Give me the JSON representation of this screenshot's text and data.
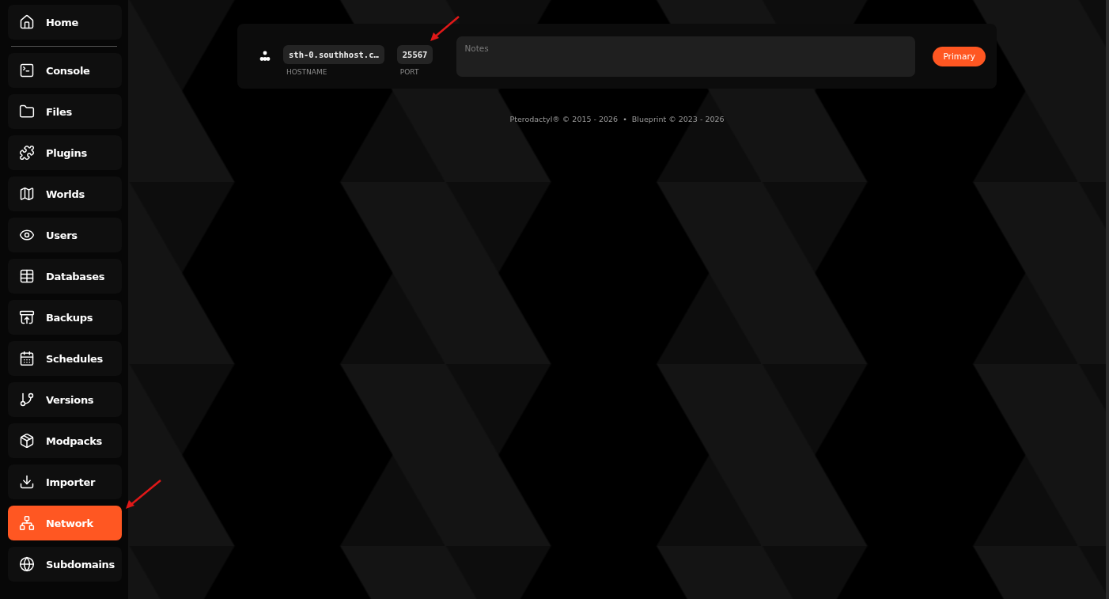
{
  "sidebar": {
    "items": [
      {
        "label": "Home",
        "selected": false
      },
      {
        "label": "Console",
        "selected": false
      },
      {
        "label": "Files",
        "selected": false
      },
      {
        "label": "Plugins",
        "selected": false
      },
      {
        "label": "Worlds",
        "selected": false
      },
      {
        "label": "Users",
        "selected": false
      },
      {
        "label": "Databases",
        "selected": false
      },
      {
        "label": "Backups",
        "selected": false
      },
      {
        "label": "Schedules",
        "selected": false
      },
      {
        "label": "Versions",
        "selected": false
      },
      {
        "label": "Modpacks",
        "selected": false
      },
      {
        "label": "Importer",
        "selected": false
      },
      {
        "label": "Network",
        "selected": true
      },
      {
        "label": "Subdomains",
        "selected": false
      }
    ]
  },
  "allocation": {
    "hostname": "sth-0.southhost.c…",
    "hostname_label": "HOSTNAME",
    "port": "25567",
    "port_label": "PORT",
    "notes": {
      "placeholder": "Notes"
    },
    "button": "Primary"
  },
  "footer": "Pterodactyl® © 2015 - 2026  •  Blueprint © 2023 - 2026"
}
